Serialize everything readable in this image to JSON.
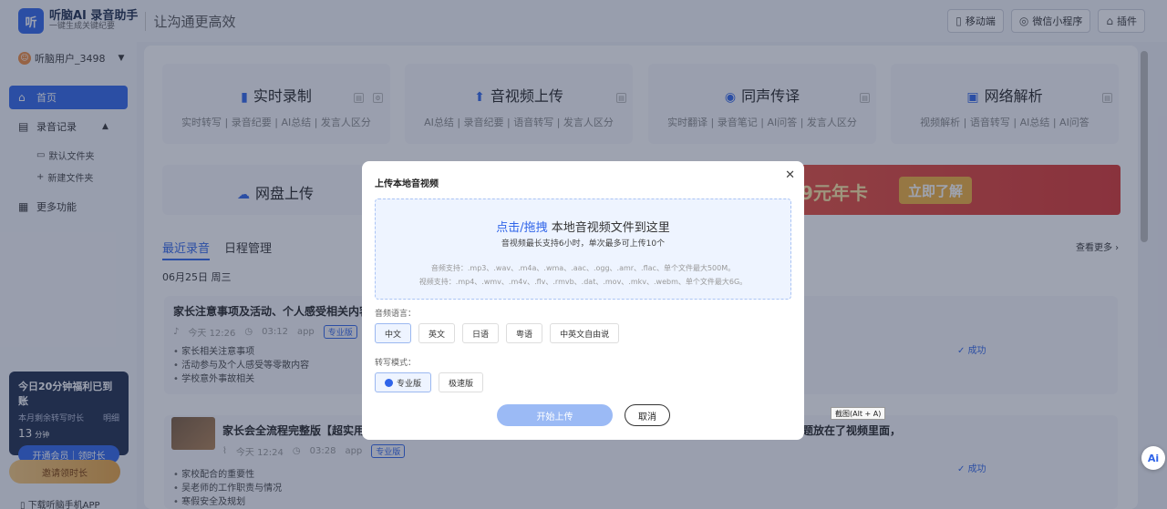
{
  "brand": {
    "logo": "听脑AI",
    "name": "听脑AI 录音助手",
    "tagline": "一键生成关键纪要",
    "slogan": "让沟通更高效"
  },
  "top_actions": [
    {
      "label": "移动端",
      "icon": "mobile-icon"
    },
    {
      "label": "微信小程序",
      "icon": "mini-program-icon"
    },
    {
      "label": "插件",
      "icon": "plugin-icon"
    }
  ],
  "user": {
    "name": "听脑用户_3498"
  },
  "sidebar": {
    "home": "首页",
    "records": "录音记录",
    "default_folder": "默认文件夹",
    "new_folder": "新建文件夹",
    "more": "更多功能"
  },
  "promo": {
    "title": "今日20分钟福利已到账",
    "remaining_label": "本月剩余转写时长",
    "detail": "明细",
    "minutes": "13",
    "unit": "分钟",
    "vip_button": "开通会员｜领时长",
    "invite_button": "邀请领时长",
    "download": "下载听脑手机APP"
  },
  "cards": [
    {
      "title": "实时录制",
      "subtitle": "实时转写 | 录音纪要 | AI总结 | 发言人区分"
    },
    {
      "title": "音视频上传",
      "subtitle": "AI总结 | 录音纪要 | 语音转写 | 发言人区分"
    },
    {
      "title": "同声传译",
      "subtitle": "实时翻译 | 录音笔记 | AI问答 | 发言人区分"
    },
    {
      "title": "网络解析",
      "subtitle": "视频解析 | 语音转写 | AI总结 | AI问答"
    },
    {
      "title": "网盘上传",
      "subtitle": ""
    }
  ],
  "banner": {
    "text": "9元年卡",
    "button": "立即了解"
  },
  "tabs": [
    "最近录音",
    "日程管理"
  ],
  "see_more": "查看更多 ›",
  "date": "06月25日 周三",
  "records": [
    {
      "title": "家长注意事项及活动、个人感受相关内容",
      "time": "今天 12:26",
      "duration": "03:12",
      "source": "app",
      "tag": "专业版",
      "bullets": [
        "家长相关注意事项",
        "活动参与及个人感受等零散内容",
        "学校意外事故相关"
      ],
      "status": "成功"
    },
    {
      "title": "家长会全流程完整版【超实用",
      "title_tail": "题放在了视频里面，",
      "time": "今天 12:24",
      "duration": "03:28",
      "source": "app",
      "tag": "专业版",
      "bullets": [
        "家校配合的重要性",
        "吴老师的工作职责与情况",
        "寒假安全及规划"
      ],
      "status": "成功"
    }
  ],
  "modal": {
    "title": "上传本地音视频",
    "drop_highlight": "点击/拖拽",
    "drop_text": "本地音视频文件到这里",
    "drop_sub": "音视频最长支持6小时，单次最多可上传10个",
    "audio_support": "音频支持：.mp3、.wav、.m4a、.wma、.aac、.ogg、.amr、.flac、单个文件最大500M。",
    "video_support": "视频支持：.mp4、.wmv、.m4v、.flv、.rmvb、.dat、.mov、.mkv、.webm、单个文件最大6G。",
    "lang_label": "音频语言：",
    "languages": [
      "中文",
      "英文",
      "日语",
      "粤语",
      "中英文自由说"
    ],
    "selected_language": "中文",
    "mode_label": "转写模式：",
    "modes": [
      "专业版",
      "极速版"
    ],
    "selected_mode": "专业版",
    "start": "开始上传",
    "cancel": "取消"
  },
  "tooltip": "截图(Alt + A)",
  "ai_button": "Ai"
}
